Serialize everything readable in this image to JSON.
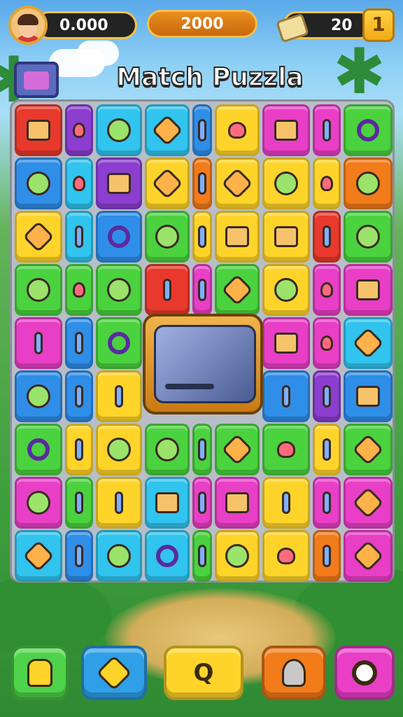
{
  "header": {
    "score_left": "0.000",
    "score_mid": "2000",
    "score_right": "20",
    "add_label": "1"
  },
  "title": "Match Puzzla",
  "center_button_label": "Q",
  "colors": {
    "red": "#e8392c",
    "purple": "#8b3ecf",
    "blue": "#2f8ee8",
    "cyan": "#31c4ee",
    "yellow": "#ffd42a",
    "magenta": "#e83fc6",
    "green": "#4bd23f",
    "orange": "#f27b1a"
  },
  "icons": {
    "bottom": [
      "creature-icon",
      "star-icon",
      "q-icon",
      "figure-icon",
      "magnifier-icon"
    ]
  },
  "board": {
    "rows": [
      [
        [
          "red",
          "box"
        ],
        [
          "purple",
          "heart"
        ],
        [
          "cyan",
          "round"
        ],
        [
          "cyan",
          "star"
        ],
        [
          "blue",
          "pill"
        ],
        [
          "yellow",
          "heart"
        ],
        [
          "magenta",
          "box"
        ],
        [
          "magenta",
          "pill"
        ],
        [
          "green",
          "ring"
        ]
      ],
      [
        [
          "blue",
          "round"
        ],
        [
          "cyan",
          "heart"
        ],
        [
          "purple",
          "box"
        ],
        [
          "yellow",
          "star"
        ],
        [
          "orange",
          "pill"
        ],
        [
          "yellow",
          "star"
        ],
        [
          "yellow",
          "round"
        ],
        [
          "yellow",
          "heart"
        ],
        [
          "orange",
          "round"
        ]
      ],
      [
        [
          "yellow",
          "star"
        ],
        [
          "cyan",
          "pill"
        ],
        [
          "blue",
          "ring"
        ],
        [
          "green",
          "round"
        ],
        [
          "yellow",
          "pill"
        ],
        [
          "yellow",
          "box"
        ],
        [
          "yellow",
          "box"
        ],
        [
          "red",
          "pill"
        ],
        [
          "green",
          "round"
        ]
      ],
      [
        [
          "green",
          "round"
        ],
        [
          "green",
          "heart"
        ],
        [
          "green",
          "round"
        ],
        [
          "red",
          "pill"
        ],
        [
          "magenta",
          "pill"
        ],
        [
          "green",
          "star"
        ],
        [
          "yellow",
          "round"
        ],
        [
          "magenta",
          "heart"
        ],
        [
          "magenta",
          "box"
        ]
      ],
      [
        [
          "magenta",
          "pill"
        ],
        [
          "blue",
          "pill"
        ],
        [
          "green",
          "ring"
        ],
        null,
        null,
        null,
        [
          "magenta",
          "box"
        ],
        [
          "magenta",
          "heart"
        ],
        [
          "cyan",
          "star"
        ]
      ],
      [
        [
          "blue",
          "round"
        ],
        [
          "blue",
          "pill"
        ],
        [
          "yellow",
          "pill"
        ],
        null,
        null,
        null,
        [
          "blue",
          "pill"
        ],
        [
          "purple",
          "pill"
        ],
        [
          "blue",
          "box"
        ]
      ],
      [
        [
          "green",
          "ring"
        ],
        [
          "yellow",
          "pill"
        ],
        [
          "yellow",
          "round"
        ],
        [
          "green",
          "round"
        ],
        [
          "green",
          "pill"
        ],
        [
          "green",
          "star"
        ],
        [
          "green",
          "heart"
        ],
        [
          "yellow",
          "pill"
        ],
        [
          "green",
          "star"
        ]
      ],
      [
        [
          "magenta",
          "round"
        ],
        [
          "green",
          "pill"
        ],
        [
          "yellow",
          "pill"
        ],
        [
          "cyan",
          "box"
        ],
        [
          "magenta",
          "pill"
        ],
        [
          "magenta",
          "box"
        ],
        [
          "yellow",
          "pill"
        ],
        [
          "magenta",
          "pill"
        ],
        [
          "magenta",
          "star"
        ]
      ],
      [
        [
          "cyan",
          "star"
        ],
        [
          "blue",
          "pill"
        ],
        [
          "cyan",
          "round"
        ],
        [
          "cyan",
          "ring"
        ],
        [
          "green",
          "pill"
        ],
        [
          "yellow",
          "round"
        ],
        [
          "yellow",
          "heart"
        ],
        [
          "orange",
          "pill"
        ],
        [
          "magenta",
          "star"
        ]
      ]
    ]
  }
}
